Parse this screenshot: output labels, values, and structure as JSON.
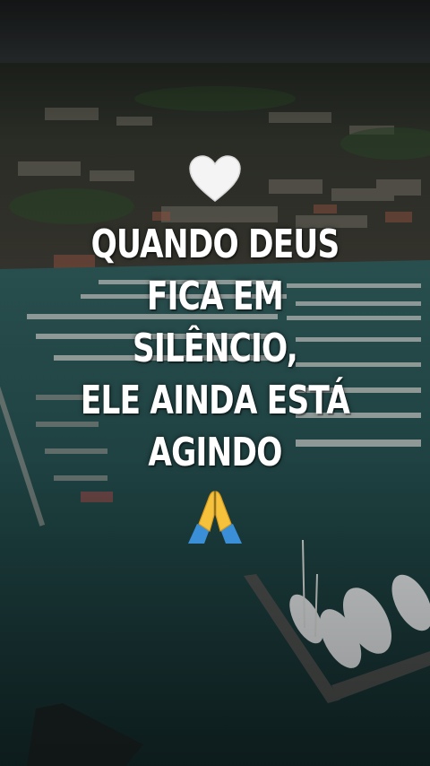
{
  "caption": {
    "lines": [
      "QUANDO DEUS",
      "FICA EM",
      "SILÊNCIO,",
      "ELE AINDA ESTÁ",
      "AGINDO"
    ]
  },
  "icons": {
    "top": "white-heart-icon",
    "bottom": "folded-hands-icon"
  },
  "colors": {
    "text": "#ffffff",
    "water": "#1f3a3b",
    "sky": "#2c3131"
  }
}
